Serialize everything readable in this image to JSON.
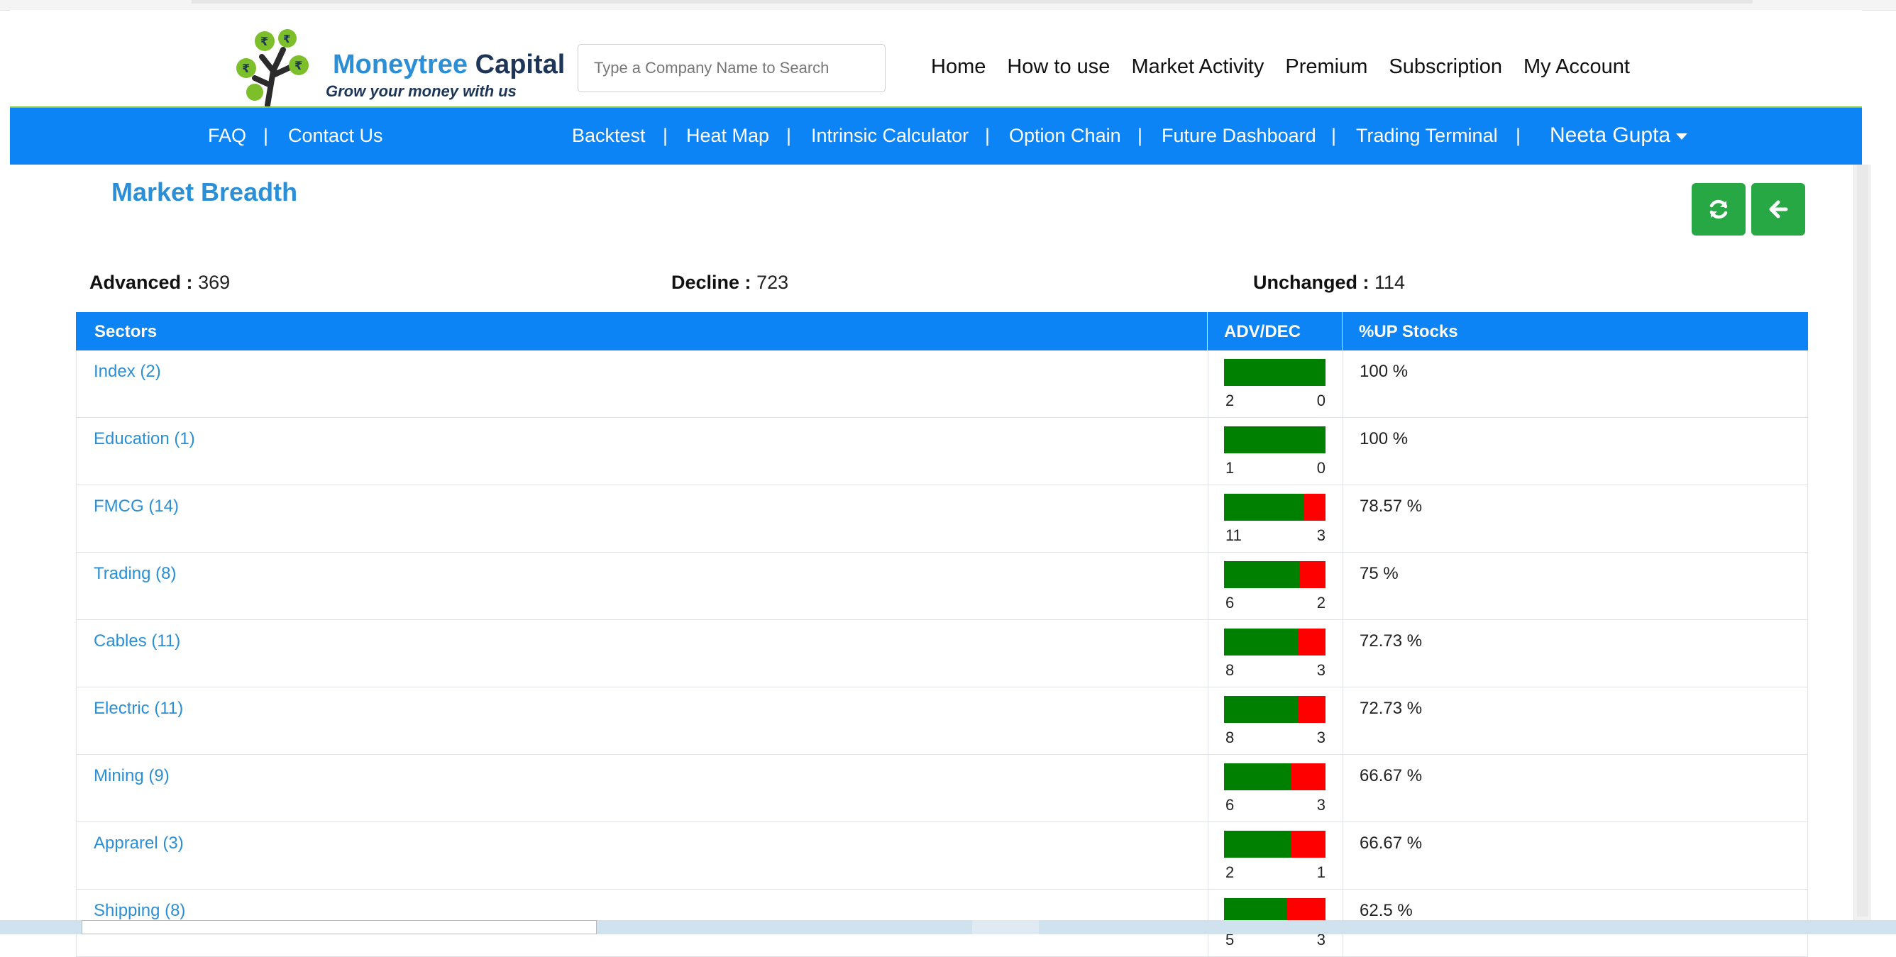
{
  "header": {
    "brand_name_1": "Moneytree",
    "brand_name_2": "Capital",
    "tagline": "Grow your money with us",
    "search_placeholder": "Type a Company Name to Search",
    "nav": [
      "Home",
      "How to use",
      "Market Activity",
      "Premium",
      "Subscription",
      "My Account"
    ]
  },
  "subnav": {
    "faq": "FAQ",
    "contact": "Contact Us",
    "separator": "|",
    "items": [
      "Backtest",
      "Heat Map",
      "Intrinsic Calculator",
      "Option Chain",
      "Future Dashboard",
      "Trading Terminal"
    ],
    "user": "Neeta Gupta"
  },
  "page": {
    "title": "Market Breadth",
    "refresh_icon": "refresh-icon",
    "back_icon": "arrow-left-icon"
  },
  "stats": {
    "advanced_label": "Advanced :",
    "advanced_value": "369",
    "decline_label": "Decline :",
    "decline_value": "723",
    "unchanged_label": "Unchanged :",
    "unchanged_value": "114"
  },
  "table": {
    "headers": [
      "Sectors",
      "ADV/DEC",
      "%UP Stocks"
    ],
    "rows": [
      {
        "sector": "Index (2)",
        "adv": 2,
        "dec": 0,
        "pct": "100 %"
      },
      {
        "sector": "Education (1)",
        "adv": 1,
        "dec": 0,
        "pct": "100 %"
      },
      {
        "sector": "FMCG (14)",
        "adv": 11,
        "dec": 3,
        "pct": "78.57 %"
      },
      {
        "sector": "Trading (8)",
        "adv": 6,
        "dec": 2,
        "pct": "75 %"
      },
      {
        "sector": "Cables (11)",
        "adv": 8,
        "dec": 3,
        "pct": "72.73 %"
      },
      {
        "sector": "Electric (11)",
        "adv": 8,
        "dec": 3,
        "pct": "72.73 %"
      },
      {
        "sector": "Mining (9)",
        "adv": 6,
        "dec": 3,
        "pct": "66.67 %"
      },
      {
        "sector": "Apprarel (3)",
        "adv": 2,
        "dec": 1,
        "pct": "66.67 %"
      },
      {
        "sector": "Shipping (8)",
        "adv": 5,
        "dec": 3,
        "pct": "62.5 %"
      }
    ]
  },
  "colors": {
    "accent_blue": "#0d84f5",
    "title_blue": "#2a8fd6",
    "adv_green": "#008000",
    "dec_red": "#ff0000",
    "button_green": "#28a745",
    "logo_green": "#8cc63f"
  }
}
